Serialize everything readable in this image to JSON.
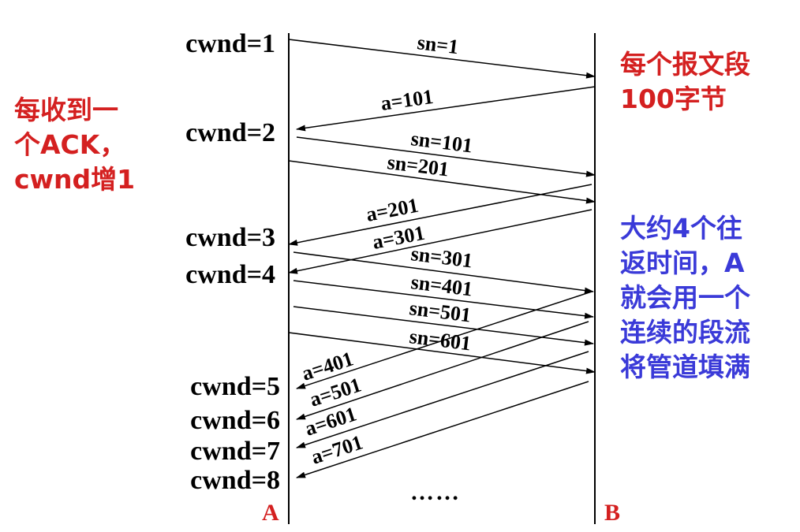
{
  "hosts": {
    "sender": "A",
    "receiver": "B"
  },
  "colors": {
    "red_note": "#d42020",
    "blue_note": "#3a3ad8",
    "lines": "#000000"
  },
  "cwnd_labels": [
    "cwnd=1",
    "cwnd=2",
    "cwnd=3",
    "cwnd=4",
    "cwnd=5",
    "cwnd=6",
    "cwnd=7",
    "cwnd=8"
  ],
  "segments": [
    "sn=1",
    "sn=101",
    "sn=201",
    "sn=301",
    "sn=401",
    "sn=501",
    "sn=601"
  ],
  "acks": [
    "a=101",
    "a=201",
    "a=301",
    "a=401",
    "a=501",
    "a=601",
    "a=701"
  ],
  "continuation": "……",
  "notes": {
    "left": [
      "每收到一",
      "个ACK，",
      "cwnd增1"
    ],
    "right_top": [
      "每个报文段",
      "100字节"
    ],
    "right_bottom": [
      "大约4个往",
      "返时间，A",
      "就会用一个",
      "连续的段流",
      "将管道填满"
    ]
  }
}
